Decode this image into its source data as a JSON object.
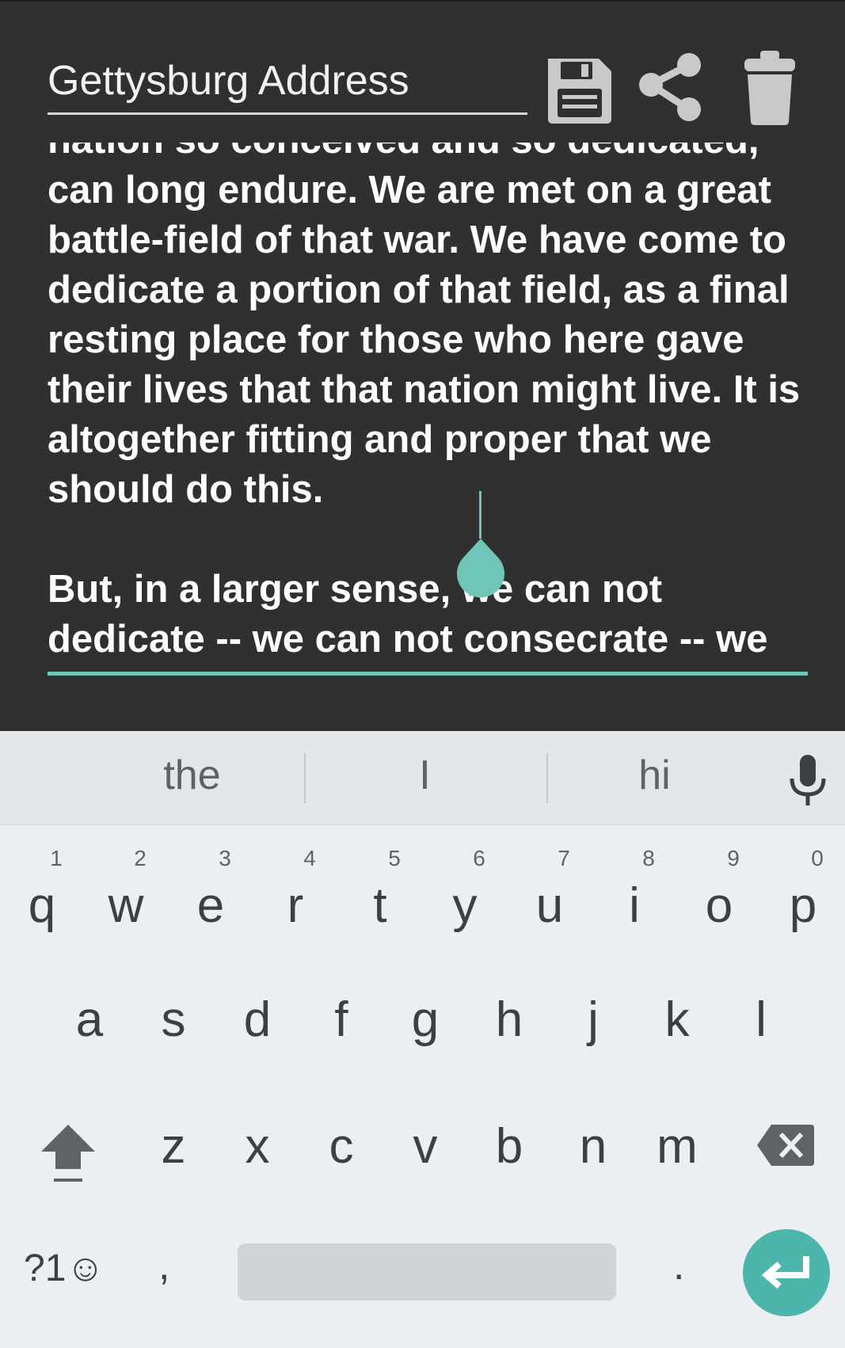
{
  "note": {
    "title": "Gettysburg Address",
    "paragraphs": [
      "nation so conceived and so dedicated, can long endure. We are met on a great battle-field of that war. We have come to dedicate a portion of that field, as a final resting place for those who here gave their lives that that nation might live. It is altogether fitting and proper that we should do this.",
      "But, in a larger sense, we can not dedicate -- we can not consecrate -- we"
    ]
  },
  "toolbar": {
    "save_icon": "floppy-disk-icon",
    "share_icon": "share-icon",
    "delete_icon": "trash-can-icon"
  },
  "keyboard": {
    "suggestions": [
      "the",
      "I",
      "hi"
    ],
    "mic_icon": "microphone-icon",
    "row1": [
      {
        "key": "q",
        "hint": "1"
      },
      {
        "key": "w",
        "hint": "2"
      },
      {
        "key": "e",
        "hint": "3"
      },
      {
        "key": "r",
        "hint": "4"
      },
      {
        "key": "t",
        "hint": "5"
      },
      {
        "key": "y",
        "hint": "6"
      },
      {
        "key": "u",
        "hint": "7"
      },
      {
        "key": "i",
        "hint": "8"
      },
      {
        "key": "o",
        "hint": "9"
      },
      {
        "key": "p",
        "hint": "0"
      }
    ],
    "row2": [
      "a",
      "s",
      "d",
      "f",
      "g",
      "h",
      "j",
      "k",
      "l"
    ],
    "row3": [
      "z",
      "x",
      "c",
      "v",
      "b",
      "n",
      "m"
    ],
    "symbols_label": "?1☺",
    "comma": ",",
    "period": ".",
    "shift_icon": "shift-arrow-icon",
    "backspace_icon": "backspace-icon",
    "enter_icon": "enter-arrow-icon"
  },
  "colors": {
    "background": "#303030",
    "accent": "#4db6ac",
    "keyboard_bg": "#eceff1"
  }
}
